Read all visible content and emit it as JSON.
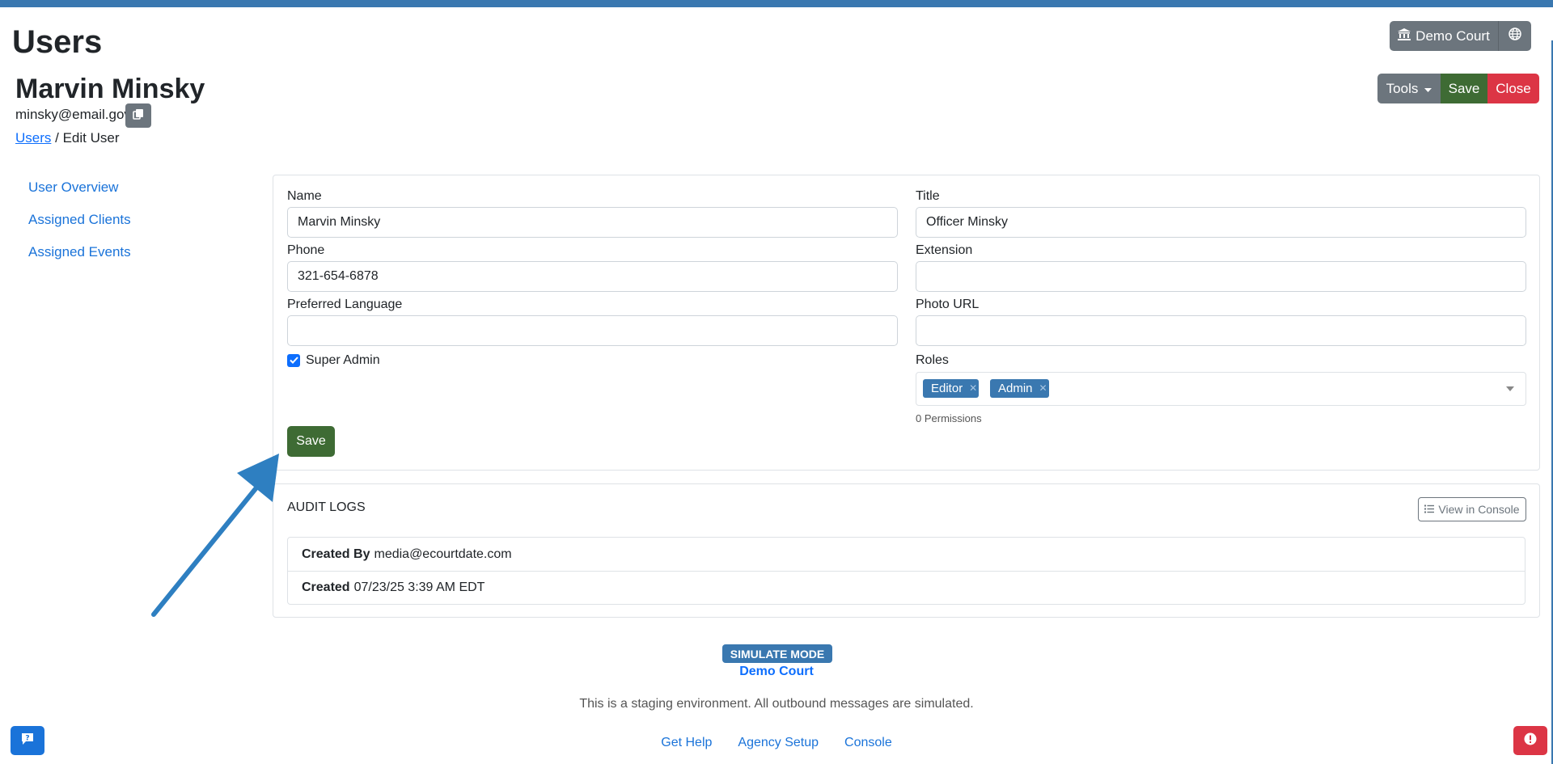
{
  "page": {
    "title": "Users"
  },
  "header": {
    "court_button": "Demo Court"
  },
  "user": {
    "name": "Marvin Minsky",
    "email": "minsky@email.gov"
  },
  "breadcrumb": {
    "parent": "Users",
    "separator": " / ",
    "current": "Edit User"
  },
  "actions": {
    "tools": "Tools",
    "save": "Save",
    "close": "Close"
  },
  "sidebar": {
    "items": [
      {
        "label": "User Overview"
      },
      {
        "label": "Assigned Clients"
      },
      {
        "label": "Assigned Events"
      }
    ]
  },
  "form": {
    "name_label": "Name",
    "name_value": "Marvin Minsky",
    "title_label": "Title",
    "title_value": "Officer Minsky",
    "phone_label": "Phone",
    "phone_value": "321-654-6878",
    "extension_label": "Extension",
    "extension_value": "",
    "language_label": "Preferred Language",
    "language_value": "",
    "photo_label": "Photo URL",
    "photo_value": "",
    "super_admin_label": "Super Admin",
    "super_admin_checked": true,
    "roles_label": "Roles",
    "roles": [
      {
        "label": "Editor"
      },
      {
        "label": "Admin"
      }
    ],
    "permissions": "0 Permissions",
    "save": "Save"
  },
  "audit": {
    "title": "AUDIT LOGS",
    "view_console": "View in Console",
    "created_by_label": "Created By",
    "created_by_value": "media@ecourtdate.com",
    "created_label": "Created",
    "created_value": "07/23/25 3:39 AM EDT"
  },
  "footer": {
    "simulate_badge": "SIMULATE MODE",
    "court": "Demo Court",
    "note": "This is a staging environment. All outbound messages are simulated.",
    "links": [
      {
        "label": "Get Help"
      },
      {
        "label": "Agency Setup"
      },
      {
        "label": "Console"
      }
    ]
  },
  "colors": {
    "primary": "#3a78b0",
    "success": "#3e6b34",
    "danger": "#dc3545",
    "secondary": "#6c757d",
    "link": "#1a73d9"
  }
}
